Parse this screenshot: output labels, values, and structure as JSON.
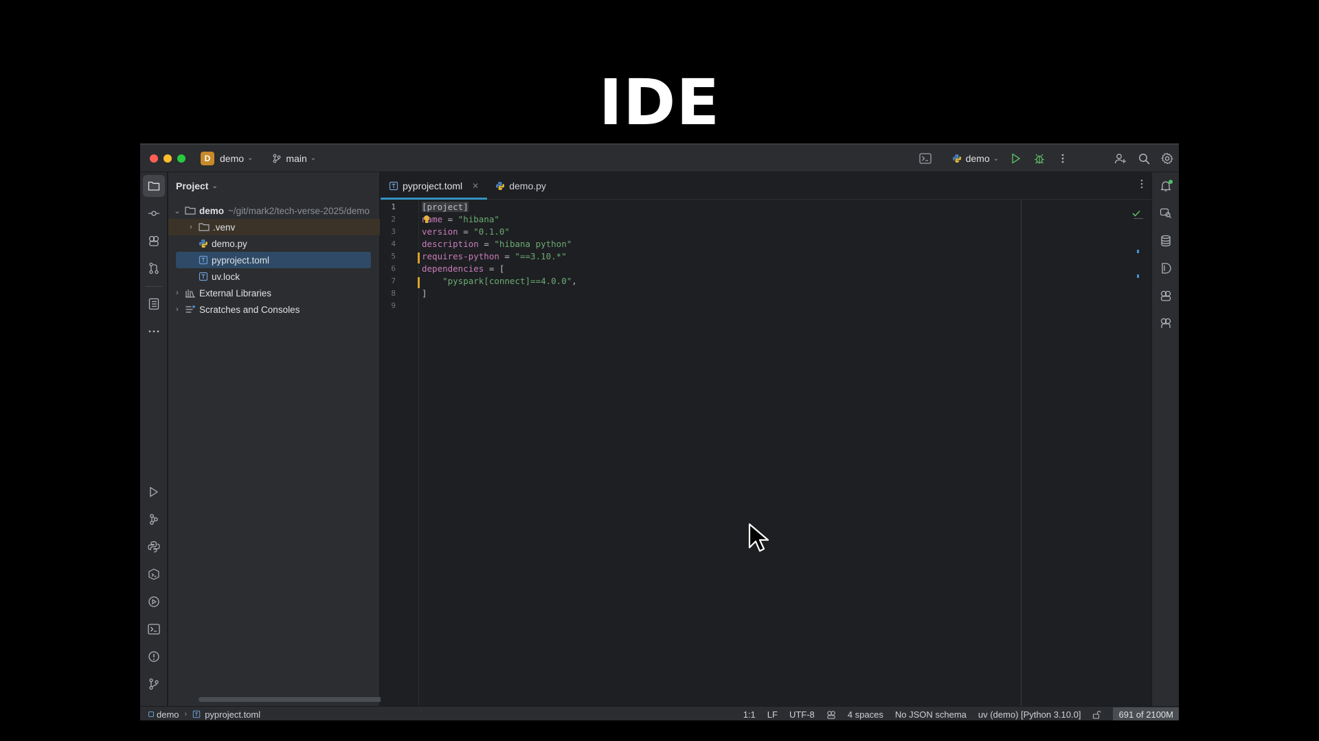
{
  "slide": {
    "title": "IDE"
  },
  "titlebar": {
    "project_initial": "D",
    "project_name": "demo",
    "branch": "main",
    "run_config": "demo"
  },
  "project_panel": {
    "header": "Project",
    "root_name": "demo",
    "root_path": "~/git/mark2/tech-verse-2025/demo",
    "items": [
      {
        "label": ".venv",
        "type": "folder"
      },
      {
        "label": "demo.py",
        "type": "python"
      },
      {
        "label": "pyproject.toml",
        "type": "toml",
        "selected": true
      },
      {
        "label": "uv.lock",
        "type": "toml"
      },
      {
        "label": "External Libraries",
        "type": "library"
      },
      {
        "label": "Scratches and Consoles",
        "type": "scratches"
      }
    ]
  },
  "editor": {
    "tabs": [
      {
        "label": "pyproject.toml",
        "active": true
      },
      {
        "label": "demo.py",
        "active": false
      }
    ],
    "line_numbers": [
      "1",
      "2",
      "3",
      "4",
      "5",
      "6",
      "7",
      "8",
      "9"
    ],
    "code": {
      "l1": "[project]",
      "l2_key": "name",
      "l2_eq": " = ",
      "l2_val": "\"hibana\"",
      "l3_key": "version",
      "l3_eq": " = ",
      "l3_val": "\"0.1.0\"",
      "l4_key": "description",
      "l4_eq": " = ",
      "l4_val": "\"hibana python\"",
      "l5_key": "requires-python",
      "l5_eq": " = ",
      "l5_val": "\"==3.10.*\"",
      "l6_key": "dependencies",
      "l6_eq": " = [",
      "l7_val": "    \"pyspark[connect]==4.0.0\"",
      "l7_comma": ",",
      "l8": "]"
    }
  },
  "statusbar": {
    "breadcrumb_root": "demo",
    "breadcrumb_file": "pyproject.toml",
    "position": "1:1",
    "line_separator": "LF",
    "encoding": "UTF-8",
    "indent": "4 spaces",
    "schema": "No JSON schema",
    "interpreter": "uv (demo) [Python 3.10.0]",
    "memory": "691 of 2100M"
  },
  "colors": {
    "accent_tab": "#3592c4",
    "selection": "#2e4a66",
    "keyword": "#c77dbb",
    "string": "#6aab73",
    "change_marker": "#d7a32a"
  }
}
